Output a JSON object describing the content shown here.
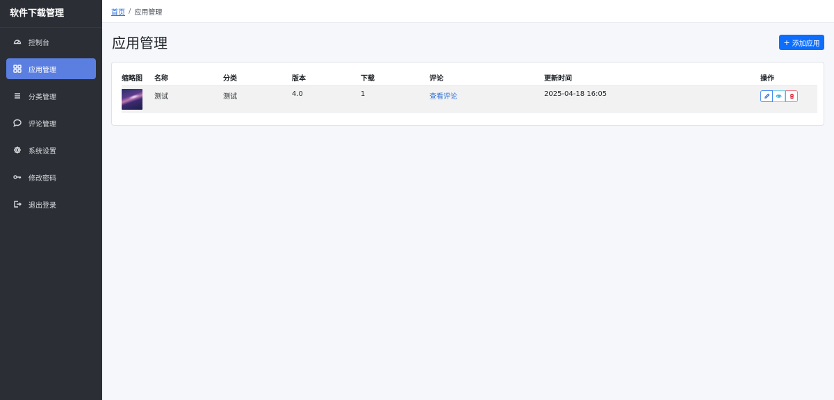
{
  "sidebar": {
    "brand": "软件下载管理",
    "items": [
      {
        "label": "控制台",
        "icon": "dashboard-icon"
      },
      {
        "label": "应用管理",
        "icon": "grid-icon",
        "active": true
      },
      {
        "label": "分类管理",
        "icon": "list-icon"
      },
      {
        "label": "评论管理",
        "icon": "comment-icon"
      },
      {
        "label": "系统设置",
        "icon": "gear-icon"
      },
      {
        "label": "修改密码",
        "icon": "key-icon"
      },
      {
        "label": "退出登录",
        "icon": "logout-icon"
      }
    ]
  },
  "breadcrumb": {
    "home": "首页",
    "separator": "/",
    "current": "应用管理"
  },
  "header": {
    "title": "应用管理",
    "add_button_icon": "+",
    "add_button_label": "添加应用"
  },
  "table": {
    "columns": [
      "缩略图",
      "名称",
      "分类",
      "版本",
      "下载",
      "评论",
      "更新时间",
      "操作"
    ],
    "rows": [
      {
        "thumbnail": "thumbnail-image",
        "name": "测试",
        "category": "测试",
        "version": "4.0",
        "downloads": "1",
        "comments_link": "查看评论",
        "updated": "2025-04-18 16:05",
        "actions": [
          "edit-icon",
          "eye-icon",
          "trash-icon"
        ]
      }
    ]
  },
  "colors": {
    "sidebar_bg": "#2b2f35",
    "active_item": "#5b7fe0",
    "primary": "#0d6efd",
    "link": "#2f6fd6",
    "danger": "#dc3545"
  }
}
